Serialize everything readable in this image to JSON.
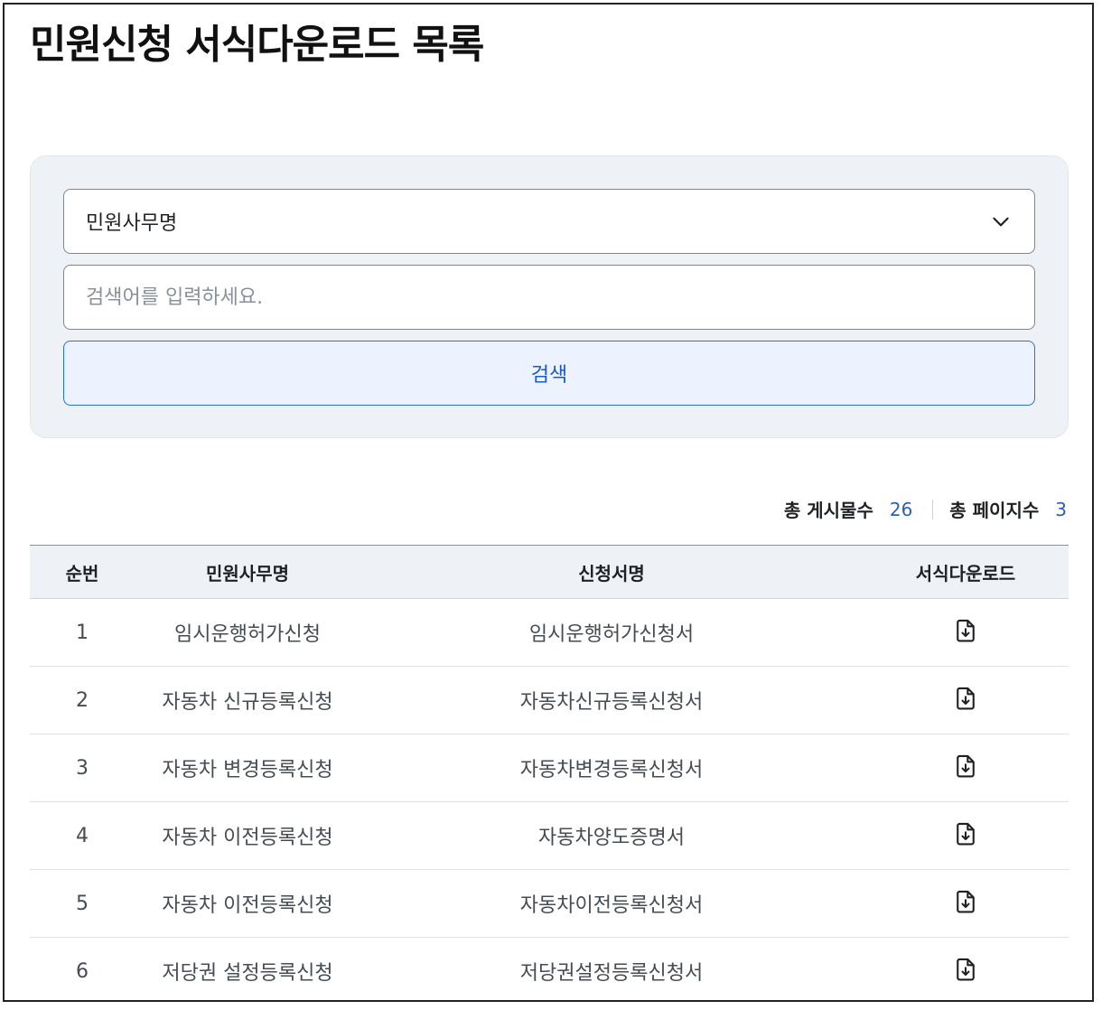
{
  "page": {
    "title": "민원신청 서식다운로드 목록"
  },
  "search": {
    "select_value": "민원사무명",
    "input_placeholder": "검색어를 입력하세요.",
    "button_label": "검색"
  },
  "summary": {
    "total_posts_label": "총 게시물수",
    "total_posts": "26",
    "total_pages_label": "총 페이지수",
    "total_pages": "3"
  },
  "table": {
    "headers": [
      "순번",
      "민원사무명",
      "신청서명",
      "서식다운로드"
    ],
    "rows": [
      {
        "no": "1",
        "service": "임시운행허가신청",
        "form": "임시운행허가신청서",
        "icon": "file-download-icon"
      },
      {
        "no": "2",
        "service": "자동차 신규등록신청",
        "form": "자동차신규등록신청서",
        "icon": "file-download-icon"
      },
      {
        "no": "3",
        "service": "자동차 변경등록신청",
        "form": "자동차변경등록신청서",
        "icon": "file-download-icon"
      },
      {
        "no": "4",
        "service": "자동차 이전등록신청",
        "form": "자동차양도증명서",
        "icon": "file-download-icon"
      },
      {
        "no": "5",
        "service": "자동차 이전등록신청",
        "form": "자동차이전등록신청서",
        "icon": "file-download-icon"
      },
      {
        "no": "6",
        "service": "저당권 설정등록신청",
        "form": "저당권설정등록신청서",
        "icon": "file-download-icon"
      }
    ]
  },
  "colors": {
    "accent": "#256ef4",
    "link_number": "#2a5fb6",
    "panel_bg": "#eef1f5"
  }
}
